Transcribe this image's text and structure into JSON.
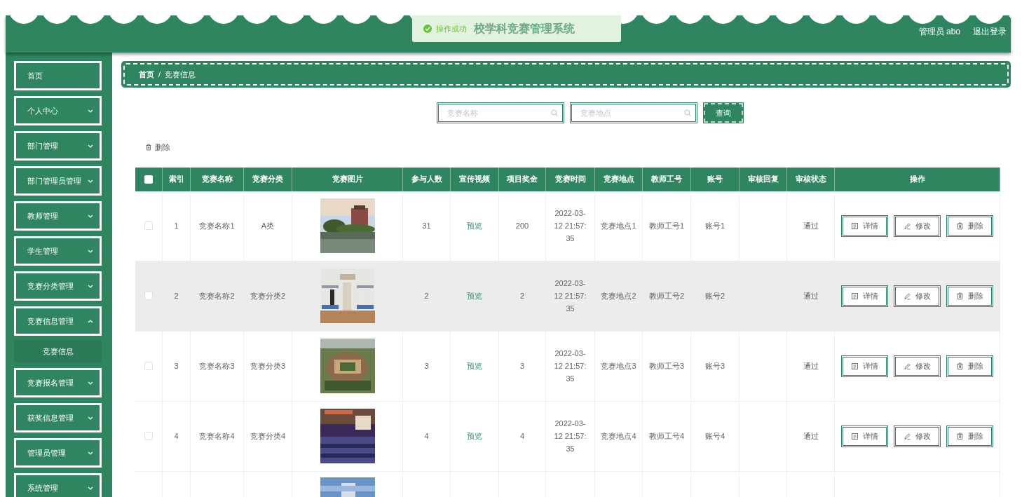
{
  "header": {
    "title": "校学科竞赛管理系统",
    "user": "管理员 abo",
    "logout": "退出登录"
  },
  "toast": {
    "message": "操作成功"
  },
  "sidebar": {
    "items": [
      {
        "label": "首页",
        "has_caret": false
      },
      {
        "label": "个人中心",
        "has_caret": true,
        "expanded": false
      },
      {
        "label": "部门管理",
        "has_caret": true,
        "expanded": false
      },
      {
        "label": "部门管理员管理",
        "has_caret": true,
        "expanded": false
      },
      {
        "label": "教师管理",
        "has_caret": true,
        "expanded": false
      },
      {
        "label": "学生管理",
        "has_caret": true,
        "expanded": false
      },
      {
        "label": "竞赛分类管理",
        "has_caret": true,
        "expanded": false
      },
      {
        "label": "竞赛信息管理",
        "has_caret": true,
        "expanded": true,
        "children": [
          {
            "label": "竞赛信息"
          }
        ]
      },
      {
        "label": "竞赛报名管理",
        "has_caret": true,
        "expanded": false
      },
      {
        "label": "获奖信息管理",
        "has_caret": true,
        "expanded": false
      },
      {
        "label": "管理员管理",
        "has_caret": true,
        "expanded": false
      },
      {
        "label": "系统管理",
        "has_caret": true,
        "expanded": false
      }
    ]
  },
  "breadcrumb": {
    "items": [
      "首页",
      "竞赛信息"
    ],
    "separator": "/"
  },
  "search": {
    "fields": [
      {
        "placeholder": "竞赛名称"
      },
      {
        "placeholder": "竞赛地点"
      }
    ],
    "button": "查询"
  },
  "toolbar": {
    "delete": "删除"
  },
  "table": {
    "header_checked": false,
    "columns": [
      "索引",
      "竞赛名称",
      "竞赛分类",
      "竞赛图片",
      "参与人数",
      "宣传视频",
      "项目奖金",
      "竞赛时间",
      "竞赛地点",
      "教师工号",
      "账号",
      "审核回复",
      "审核状态",
      "操作"
    ],
    "rows": [
      {
        "kind": "full",
        "checked": false,
        "highlighted": false,
        "cells": [
          "1",
          "竞赛名称1",
          "A类",
          "",
          "31",
          "预览",
          "200",
          "2022-03-12 21:57:35",
          "竞赛地点1",
          "教师工号1",
          "账号1",
          "",
          "通过"
        ],
        "actions": [
          "详情",
          "修改",
          "删除"
        ]
      },
      {
        "kind": "full",
        "checked": false,
        "highlighted": true,
        "cells": [
          "2",
          "竞赛名称2",
          "竞赛分类2",
          "",
          "2",
          "预览",
          "2",
          "2022-03-12 21:57:35",
          "竞赛地点2",
          "教师工号2",
          "账号2",
          "",
          "通过"
        ],
        "actions": [
          "详情",
          "修改",
          "删除"
        ]
      },
      {
        "kind": "full",
        "checked": false,
        "highlighted": false,
        "cells": [
          "3",
          "竞赛名称3",
          "竞赛分类3",
          "",
          "3",
          "预览",
          "3",
          "2022-03-12 21:57:35",
          "竞赛地点3",
          "教师工号3",
          "账号3",
          "",
          "通过"
        ],
        "actions": [
          "详情",
          "修改",
          "删除"
        ]
      },
      {
        "kind": "full",
        "checked": false,
        "highlighted": false,
        "cells": [
          "4",
          "竞赛名称4",
          "竞赛分类4",
          "",
          "4",
          "预览",
          "4",
          "2022-03-12 21:57:35",
          "竞赛地点4",
          "教师工号4",
          "账号4",
          "",
          "通过"
        ],
        "actions": [
          "详情",
          "修改",
          "删除"
        ]
      },
      {
        "kind": "partial"
      }
    ]
  }
}
